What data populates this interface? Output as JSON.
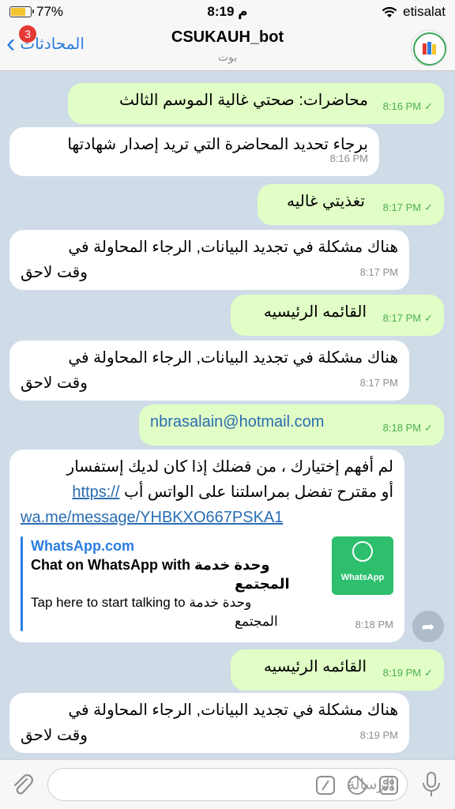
{
  "status": {
    "battery": "77%",
    "battery_level": 0.77,
    "time": "8:19 م",
    "carrier": "etisalat"
  },
  "header": {
    "back_label": "المحادثات",
    "unread_count": "3",
    "title": "CSUKAUH_bot",
    "subtitle": "بوت"
  },
  "messages": [
    {
      "dir": "out",
      "text": "محاضرات: صحتي غالية الموسم الثالث",
      "time": "8:16 PM"
    },
    {
      "dir": "in",
      "text": "برجاء تحديد المحاضرة التي تريد إصدار شهادتها",
      "time": "8:16 PM"
    },
    {
      "dir": "out",
      "text": "تغذيتي غاليه",
      "time": "8:17 PM"
    },
    {
      "dir": "in",
      "text_line1": "هناك مشكلة في تجديد البيانات, الرجاء المحاولة في",
      "text_line2": "وقت لاحق",
      "time": "8:17 PM"
    },
    {
      "dir": "out",
      "text": "القائمه الرئيسيه",
      "time": "8:17 PM"
    },
    {
      "dir": "in",
      "text_line1": "هناك مشكلة في تجديد البيانات, الرجاء المحاولة في",
      "text_line2": "وقت لاحق",
      "time": "8:17 PM"
    },
    {
      "dir": "out",
      "text": "nbrasalain@hotmail.com",
      "time": "8:18 PM"
    },
    {
      "dir": "in",
      "text_line1": "لم أفهم إختيارك ، من فضلك إذا كان لديك إستفسار",
      "text_line2": "أو مقترح تفضل بمراسلتنا على الواتس أب",
      "link_part1": "https://",
      "link_part2": "wa.me/message/YHBKXO667PSKA1",
      "preview_site": "WhatsApp.com",
      "preview_title_line1": "Chat on WhatsApp with وحدة خدمة",
      "preview_title_line2": "المجتمع",
      "preview_desc_line1": "Tap here to start talking to وحدة خدمة",
      "preview_desc_line2": "المجتمع",
      "preview_thumb_label": "WhatsApp",
      "time": "8:18 PM"
    },
    {
      "dir": "out",
      "text": "القائمه الرئيسيه",
      "time": "8:19 PM"
    },
    {
      "dir": "in",
      "text_line1": "هناك مشكلة في تجديد البيانات, الرجاء المحاولة في",
      "text_line2": "وقت لاحق",
      "time": "8:19 PM"
    }
  ],
  "composer": {
    "placeholder": "الرسالة"
  },
  "colors": {
    "accent": "#2b7de1",
    "outgoing_bubble": "#e1fec6",
    "incoming_bubble": "#ffffff",
    "chat_bg": "#cfdbe7",
    "badge": "#e53935"
  }
}
